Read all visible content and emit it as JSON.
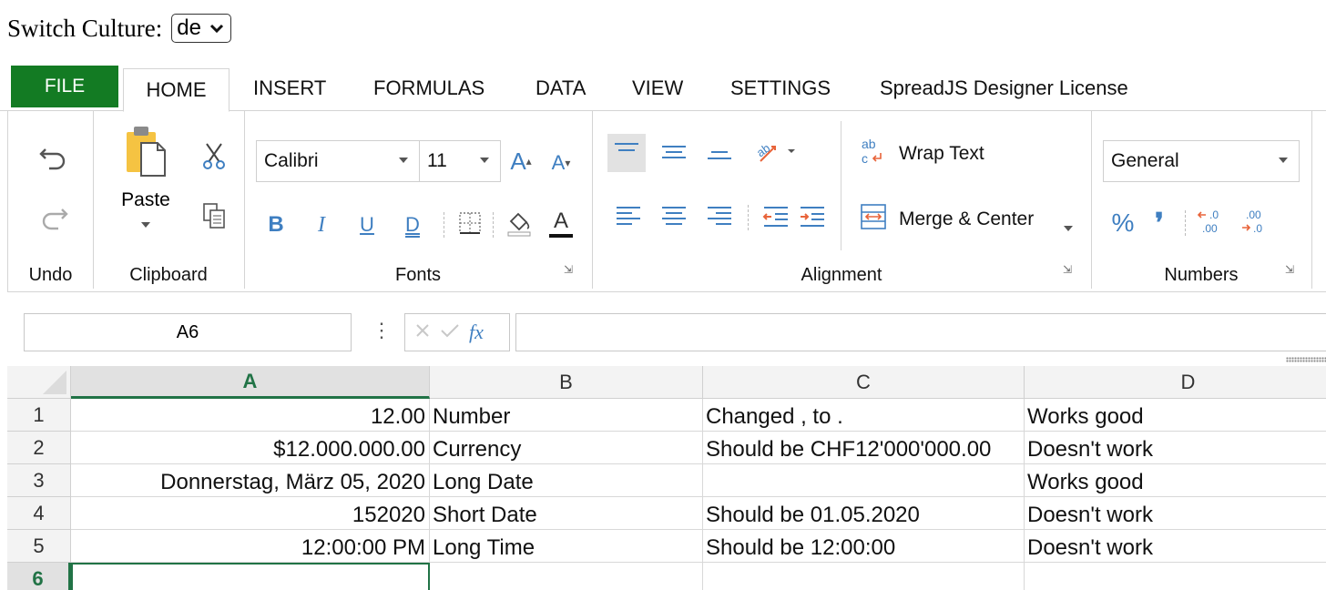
{
  "culture": {
    "label": "Switch Culture:",
    "value": "de"
  },
  "tabs": [
    {
      "label": "FILE"
    },
    {
      "label": "HOME"
    },
    {
      "label": "INSERT"
    },
    {
      "label": "FORMULAS"
    },
    {
      "label": "DATA"
    },
    {
      "label": "VIEW"
    },
    {
      "label": "SETTINGS"
    },
    {
      "label": "SpreadJS Designer License"
    }
  ],
  "ribbon": {
    "undo_group": "Undo",
    "clipboard_group": "Clipboard",
    "paste_label": "Paste",
    "fonts_group": "Fonts",
    "font_name": "Calibri",
    "font_size": "11",
    "bold": "B",
    "italic": "I",
    "underline": "U",
    "double_underline": "D",
    "grow_font": "A",
    "shrink_font": "A",
    "font_color": "A",
    "alignment_group": "Alignment",
    "wrap_text": "Wrap Text",
    "merge_center": "Merge & Center",
    "numbers_group": "Numbers",
    "number_format": "General",
    "percent": "%",
    "comma": "❜"
  },
  "formula_bar": {
    "name_box": "A6",
    "fx": "fx",
    "value": ""
  },
  "sheet": {
    "columns": [
      "A",
      "B",
      "C",
      "D"
    ],
    "selected_column": "A",
    "selected_row": "6",
    "rows": [
      {
        "num": "1",
        "cells": [
          "12.00",
          "Number",
          "Changed , to .",
          "Works good"
        ]
      },
      {
        "num": "2",
        "cells": [
          "$12.000.000.00",
          "Currency",
          "Should be CHF12'000'000.00",
          "Doesn't work"
        ]
      },
      {
        "num": "3",
        "cells": [
          "Donnerstag, März 05, 2020",
          "Long Date",
          "",
          "Works good"
        ]
      },
      {
        "num": "4",
        "cells": [
          "152020",
          "Short Date",
          "Should be 01.05.2020",
          "Doesn't work"
        ]
      },
      {
        "num": "5",
        "cells": [
          "12:00:00 PM",
          "Long Time",
          "Should be 12:00:00",
          "Doesn't work"
        ]
      },
      {
        "num": "6",
        "cells": [
          "",
          "",
          "",
          ""
        ]
      }
    ]
  },
  "colors": {
    "file_tab": "#137b23",
    "selection": "#217346",
    "icon_blue": "#3f7fc1",
    "icon_orange": "#e8643a"
  }
}
